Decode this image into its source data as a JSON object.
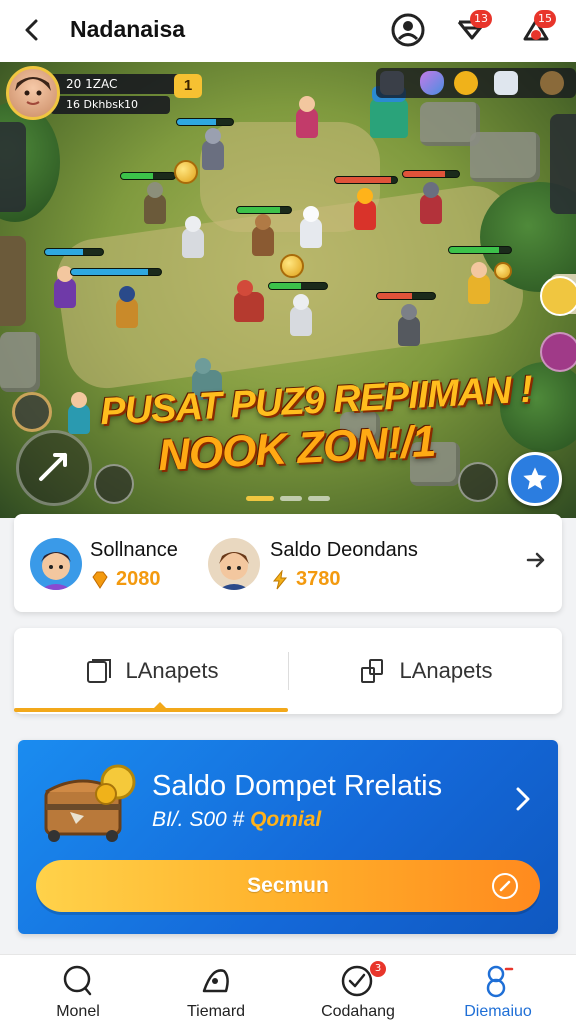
{
  "header": {
    "title": "Nadanaisa",
    "notification_badge": "13",
    "alert_badge": "15"
  },
  "game": {
    "player": {
      "stats_line1": "20 1ZAC",
      "stats_line2": "16 Dkhbsk",
      "stats_value": "10",
      "level": "1"
    },
    "promo_line1": "PUSAT PUZ9 REPIIMAN !",
    "promo_line2": "NOOK ZON!/1",
    "carousel_active_index": 0
  },
  "leaderboard": {
    "players": [
      {
        "name": "Sollnance",
        "score": "2080",
        "gem_icon": "diamond-icon"
      },
      {
        "name": "Saldo Deondans",
        "score": "3780",
        "gem_icon": "lightning-icon"
      }
    ]
  },
  "tabs": [
    {
      "label": "LAnapets",
      "icon": "document-icon"
    },
    {
      "label": "LAnapets",
      "icon": "stack-icon"
    }
  ],
  "wallet": {
    "title": "Saldo Dompet Rrelatis",
    "subtitle_prefix": "BI/. S00 #",
    "subtitle_highlight": "Qomial",
    "cta_label": "Secmun"
  },
  "bottom_nav": [
    {
      "label": "Monel",
      "icon": "search-icon"
    },
    {
      "label": "Tiemard",
      "icon": "bell-icon"
    },
    {
      "label": "Codahang",
      "icon": "check-circle-icon",
      "badge": "3"
    },
    {
      "label": "Diemaiuo",
      "icon": "profile-icon"
    }
  ],
  "colors": {
    "accent_blue": "#1468d8",
    "accent_orange": "#f39a0f",
    "active_nav": "#1f6fd6",
    "badge_red": "#e8352b"
  }
}
